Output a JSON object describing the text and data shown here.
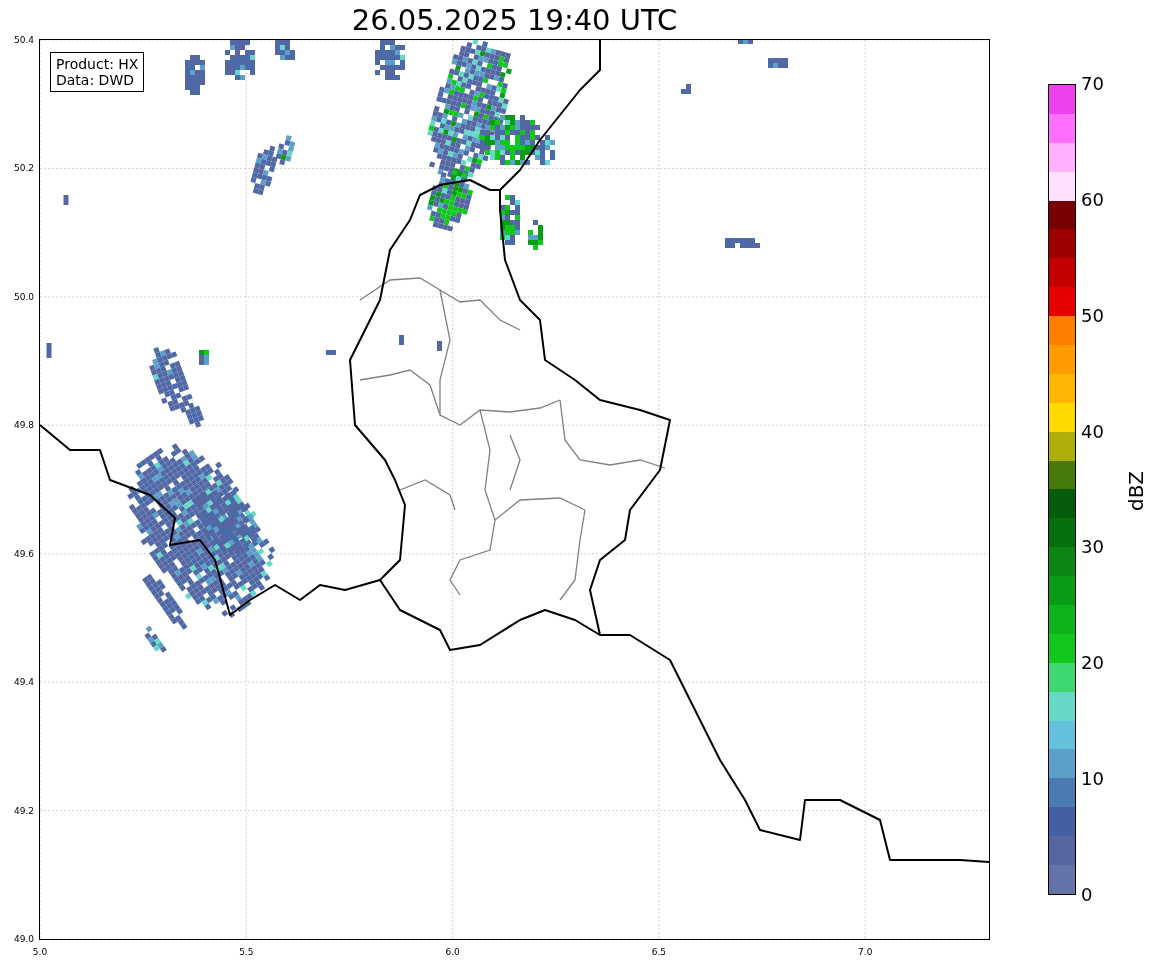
{
  "figure": {
    "title": "26.05.2025 19:40 UTC"
  },
  "map": {
    "info_lines": [
      "Product: HX",
      "Data: DWD"
    ],
    "x_ticks": [
      "5.0",
      "5.5",
      "6.0",
      "6.5",
      "7.0"
    ],
    "y_ticks": [
      "50.4",
      "50.2",
      "50.0",
      "49.8",
      "49.6",
      "49.4",
      "49.2",
      "49.0"
    ]
  },
  "colorbar": {
    "label": "dBZ",
    "ticks": [
      "70",
      "60",
      "50",
      "40",
      "30",
      "20",
      "10",
      "0"
    ],
    "bands": [
      {
        "color": "#ee3fee"
      },
      {
        "color": "#fe6ffe"
      },
      {
        "color": "#ffb0ff"
      },
      {
        "color": "#ffe0ff"
      },
      {
        "color": "#780000"
      },
      {
        "color": "#9e0000"
      },
      {
        "color": "#c20000"
      },
      {
        "color": "#e60000"
      },
      {
        "color": "#ff7d00"
      },
      {
        "color": "#ff9a00"
      },
      {
        "color": "#ffb600"
      },
      {
        "color": "#ffd800"
      },
      {
        "color": "#adae0a"
      },
      {
        "color": "#477a0a"
      },
      {
        "color": "#055c0a"
      },
      {
        "color": "#076f0e"
      },
      {
        "color": "#0b8612"
      },
      {
        "color": "#0b9c16"
      },
      {
        "color": "#0eb21a"
      },
      {
        "color": "#12c81c"
      },
      {
        "color": "#3ed66e"
      },
      {
        "color": "#66d8c8"
      },
      {
        "color": "#65c0dc"
      },
      {
        "color": "#5aa0c8"
      },
      {
        "color": "#4b7ab3"
      },
      {
        "color": "#4460a4"
      },
      {
        "color": "#5566a0"
      },
      {
        "color": "#6474a8"
      }
    ]
  }
}
